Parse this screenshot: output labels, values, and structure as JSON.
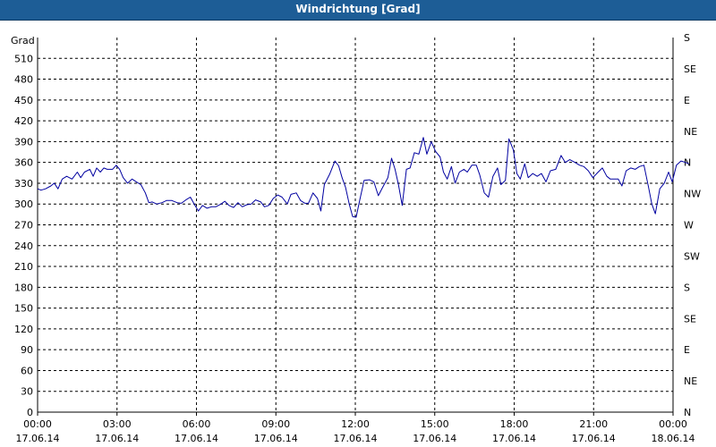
{
  "window": {
    "title": "Windrichtung [Grad]"
  },
  "chart_data": {
    "type": "line",
    "title": "Windrichtung [Grad]",
    "ylabel": "Grad",
    "xlabel": "",
    "ylim": [
      0,
      540
    ],
    "xlim_hours": [
      0,
      24
    ],
    "y_ticks": [
      0,
      30,
      60,
      90,
      120,
      150,
      180,
      210,
      240,
      270,
      300,
      330,
      360,
      390,
      420,
      450,
      480,
      510
    ],
    "y_ticks_right": [
      {
        "value": 0,
        "label": "N"
      },
      {
        "value": 45,
        "label": "NE"
      },
      {
        "value": 90,
        "label": "E"
      },
      {
        "value": 135,
        "label": "SE"
      },
      {
        "value": 180,
        "label": "S"
      },
      {
        "value": 225,
        "label": "SW"
      },
      {
        "value": 270,
        "label": "W"
      },
      {
        "value": 315,
        "label": "NW"
      },
      {
        "value": 360,
        "label": "N"
      },
      {
        "value": 405,
        "label": "NE"
      },
      {
        "value": 450,
        "label": "E"
      },
      {
        "value": 495,
        "label": "SE"
      },
      {
        "value": 540,
        "label": "S"
      }
    ],
    "x_ticks": [
      {
        "hour": 0,
        "time": "00:00",
        "date": "17.06.14"
      },
      {
        "hour": 3,
        "time": "03:00",
        "date": "17.06.14"
      },
      {
        "hour": 6,
        "time": "06:00",
        "date": "17.06.14"
      },
      {
        "hour": 9,
        "time": "09:00",
        "date": "17.06.14"
      },
      {
        "hour": 12,
        "time": "12:00",
        "date": "17.06.14"
      },
      {
        "hour": 15,
        "time": "15:00",
        "date": "17.06.14"
      },
      {
        "hour": 18,
        "time": "18:00",
        "date": "17.06.14"
      },
      {
        "hour": 21,
        "time": "21:00",
        "date": "17.06.14"
      },
      {
        "hour": 24,
        "time": "00:00",
        "date": "18.06.14"
      }
    ],
    "grid": true,
    "series": [
      {
        "color": "#0000a0",
        "points": [
          [
            0.0,
            322
          ],
          [
            0.13,
            320
          ],
          [
            0.3,
            322
          ],
          [
            0.5,
            326
          ],
          [
            0.63,
            330
          ],
          [
            0.77,
            322
          ],
          [
            0.93,
            336
          ],
          [
            1.1,
            340
          ],
          [
            1.3,
            336
          ],
          [
            1.5,
            346
          ],
          [
            1.63,
            338
          ],
          [
            1.77,
            346
          ],
          [
            1.97,
            350
          ],
          [
            2.1,
            340
          ],
          [
            2.23,
            352
          ],
          [
            2.37,
            346
          ],
          [
            2.5,
            352
          ],
          [
            2.63,
            350
          ],
          [
            2.83,
            350
          ],
          [
            2.97,
            356
          ],
          [
            3.1,
            350
          ],
          [
            3.23,
            338
          ],
          [
            3.4,
            330
          ],
          [
            3.57,
            336
          ],
          [
            3.73,
            332
          ],
          [
            3.9,
            328
          ],
          [
            4.07,
            316
          ],
          [
            4.2,
            302
          ],
          [
            4.33,
            303
          ],
          [
            4.5,
            300
          ],
          [
            4.7,
            302
          ],
          [
            4.87,
            305
          ],
          [
            5.07,
            305
          ],
          [
            5.27,
            302
          ],
          [
            5.43,
            301
          ],
          [
            5.6,
            306
          ],
          [
            5.77,
            310
          ],
          [
            5.93,
            299
          ],
          [
            6.07,
            290
          ],
          [
            6.23,
            298
          ],
          [
            6.4,
            294
          ],
          [
            6.57,
            296
          ],
          [
            6.73,
            296
          ],
          [
            6.93,
            300
          ],
          [
            7.07,
            304
          ],
          [
            7.23,
            298
          ],
          [
            7.4,
            295
          ],
          [
            7.57,
            302
          ],
          [
            7.73,
            296
          ],
          [
            7.9,
            299
          ],
          [
            8.07,
            300
          ],
          [
            8.23,
            306
          ],
          [
            8.43,
            303
          ],
          [
            8.57,
            296
          ],
          [
            8.73,
            298
          ],
          [
            8.9,
            308
          ],
          [
            9.07,
            313
          ],
          [
            9.23,
            310
          ],
          [
            9.43,
            300
          ],
          [
            9.57,
            314
          ],
          [
            9.77,
            316
          ],
          [
            9.93,
            305
          ],
          [
            10.1,
            301
          ],
          [
            10.23,
            301
          ],
          [
            10.4,
            316
          ],
          [
            10.57,
            308
          ],
          [
            10.7,
            290
          ],
          [
            10.83,
            328
          ],
          [
            11.03,
            343
          ],
          [
            11.23,
            362
          ],
          [
            11.37,
            355
          ],
          [
            11.5,
            338
          ],
          [
            11.63,
            324
          ],
          [
            11.77,
            300
          ],
          [
            11.9,
            282
          ],
          [
            12.03,
            281
          ],
          [
            12.17,
            306
          ],
          [
            12.33,
            334
          ],
          [
            12.53,
            335
          ],
          [
            12.7,
            332
          ],
          [
            12.87,
            312
          ],
          [
            13.03,
            324
          ],
          [
            13.23,
            338
          ],
          [
            13.37,
            366
          ],
          [
            13.5,
            350
          ],
          [
            13.63,
            328
          ],
          [
            13.77,
            298
          ],
          [
            13.93,
            350
          ],
          [
            14.07,
            352
          ],
          [
            14.23,
            374
          ],
          [
            14.4,
            372
          ],
          [
            14.57,
            396
          ],
          [
            14.7,
            372
          ],
          [
            14.87,
            390
          ],
          [
            15.03,
            376
          ],
          [
            15.2,
            368
          ],
          [
            15.33,
            346
          ],
          [
            15.47,
            336
          ],
          [
            15.63,
            354
          ],
          [
            15.77,
            330
          ],
          [
            15.93,
            346
          ],
          [
            16.1,
            350
          ],
          [
            16.23,
            346
          ],
          [
            16.4,
            356
          ],
          [
            16.57,
            356
          ],
          [
            16.7,
            342
          ],
          [
            16.87,
            316
          ],
          [
            17.03,
            310
          ],
          [
            17.2,
            340
          ],
          [
            17.37,
            352
          ],
          [
            17.5,
            328
          ],
          [
            17.67,
            334
          ],
          [
            17.8,
            394
          ],
          [
            17.97,
            378
          ],
          [
            18.1,
            344
          ],
          [
            18.23,
            336
          ],
          [
            18.4,
            358
          ],
          [
            18.53,
            338
          ],
          [
            18.7,
            344
          ],
          [
            18.87,
            340
          ],
          [
            19.03,
            344
          ],
          [
            19.2,
            332
          ],
          [
            19.37,
            348
          ],
          [
            19.57,
            350
          ],
          [
            19.77,
            370
          ],
          [
            19.93,
            360
          ],
          [
            20.1,
            364
          ],
          [
            20.3,
            360
          ],
          [
            20.47,
            356
          ],
          [
            20.63,
            354
          ],
          [
            20.8,
            348
          ],
          [
            20.97,
            338
          ],
          [
            21.17,
            346
          ],
          [
            21.33,
            352
          ],
          [
            21.5,
            340
          ],
          [
            21.63,
            336
          ],
          [
            21.8,
            336
          ],
          [
            21.93,
            336
          ],
          [
            22.07,
            326
          ],
          [
            22.23,
            348
          ],
          [
            22.4,
            352
          ],
          [
            22.57,
            350
          ],
          [
            22.73,
            354
          ],
          [
            22.9,
            356
          ],
          [
            23.07,
            325
          ],
          [
            23.2,
            300
          ],
          [
            23.33,
            286
          ],
          [
            23.5,
            322
          ],
          [
            23.67,
            330
          ],
          [
            23.83,
            346
          ],
          [
            23.97,
            332
          ],
          [
            24.13,
            356
          ],
          [
            24.3,
            362
          ],
          [
            24.47,
            360
          ],
          [
            24.6,
            358
          ]
        ]
      }
    ]
  }
}
